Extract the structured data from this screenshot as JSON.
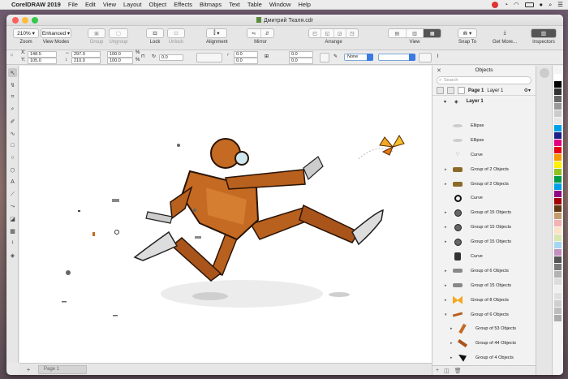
{
  "menubar": {
    "app": "CorelDRAW 2019",
    "items": [
      "File",
      "Edit",
      "View",
      "Layout",
      "Object",
      "Effects",
      "Bitmaps",
      "Text",
      "Table",
      "Window",
      "Help"
    ]
  },
  "window": {
    "title": "Дмитрий Ткаля.cdr"
  },
  "toolbar": {
    "zoom_value": "210%",
    "zoom_label": "Zoom",
    "view_mode_value": "Enhanced",
    "view_mode_label": "View Modes",
    "group_label": "Group",
    "ungroup_label": "Ungroup",
    "lock_label": "Lock",
    "unlock_label": "Unlock",
    "alignment_label": "Alignment",
    "mirror_label": "Mirror",
    "arrange_label": "Arrange",
    "view_label": "View",
    "snap_label": "Snap To",
    "getmore_label": "Get More...",
    "inspectors_label": "Inspectors"
  },
  "propbar": {
    "x": "148.5",
    "y": "105.0",
    "w": "297.0",
    "h": "210.0",
    "sx": "100.0",
    "sy": "100.0",
    "pct1": "%",
    "pct2": "%",
    "angle": "0.0",
    "o1": "0.0",
    "o2": "0.0",
    "o3": "0.0",
    "o4": "0.0",
    "outline": "None"
  },
  "pages": {
    "current_tab": "Page 1"
  },
  "objects_panel": {
    "title": "Objects",
    "search_placeholder": "Search",
    "page_label": "Page 1",
    "layer_in_page": "Layer 1",
    "layer_label": "Layer 1",
    "rows": [
      {
        "name": "Ellipse",
        "thumb": "ellipse",
        "expand": false,
        "sub": false
      },
      {
        "name": "Ellipse",
        "thumb": "ellipse",
        "expand": false,
        "sub": false
      },
      {
        "name": "Curve",
        "thumb": "curve-dots",
        "expand": false,
        "sub": false
      },
      {
        "name": "Group of 2 Objects",
        "thumb": "bolt",
        "expand": true,
        "sub": false
      },
      {
        "name": "Group of 2 Objects",
        "thumb": "bolt",
        "expand": true,
        "sub": false
      },
      {
        "name": "Curve",
        "thumb": "ring",
        "expand": false,
        "sub": false
      },
      {
        "name": "Group of 15 Objects",
        "thumb": "nut",
        "expand": true,
        "sub": false
      },
      {
        "name": "Group of 15 Objects",
        "thumb": "nut",
        "expand": true,
        "sub": false
      },
      {
        "name": "Group of 15 Objects",
        "thumb": "nut",
        "expand": true,
        "sub": false
      },
      {
        "name": "Curve",
        "thumb": "hand",
        "expand": false,
        "sub": false
      },
      {
        "name": "Group of 6 Objects",
        "thumb": "bolt-grey",
        "expand": true,
        "sub": false
      },
      {
        "name": "Group of 15 Objects",
        "thumb": "bolt-grey",
        "expand": true,
        "sub": false
      },
      {
        "name": "Group of 8 Objects",
        "thumb": "butterfly",
        "expand": true,
        "sub": false
      },
      {
        "name": "Group of 6 Objects",
        "thumb": "robot",
        "expand": "open",
        "sub": false
      },
      {
        "name": "Group of 53 Objects",
        "thumb": "arm",
        "expand": true,
        "sub": true
      },
      {
        "name": "Group of 44 Objects",
        "thumb": "leg",
        "expand": true,
        "sub": true
      },
      {
        "name": "Group of 4 Objects",
        "thumb": "shoe",
        "expand": true,
        "sub": true
      }
    ]
  }
}
